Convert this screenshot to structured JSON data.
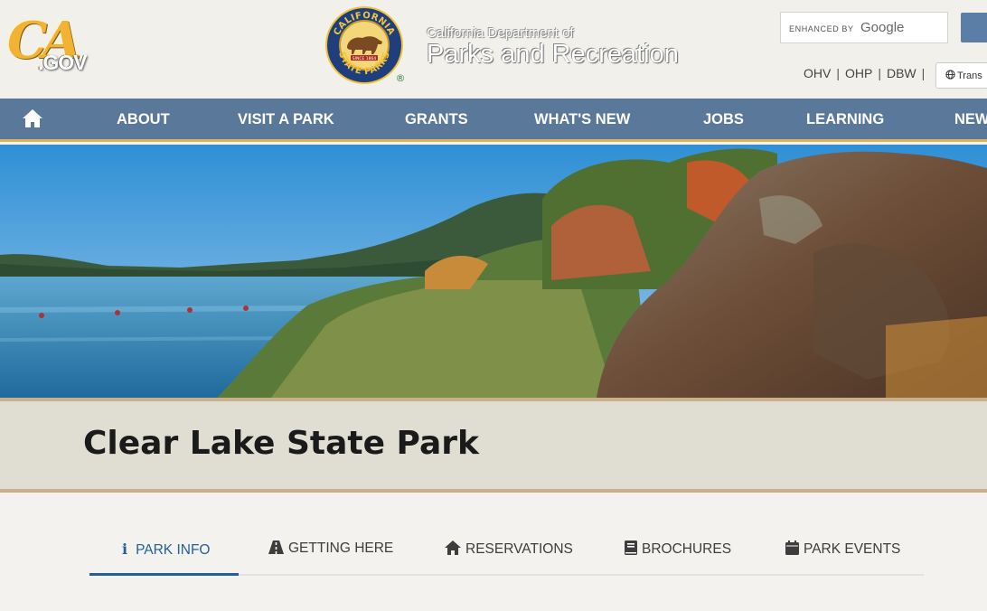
{
  "header": {
    "ca_logo_text": "CA",
    "ca_logo_suffix": ".GOV",
    "seal_top": "CALIFORNIA",
    "seal_bottom": "STATE PARKS",
    "seal_year": "SINCE 1864",
    "seal_mark": "®",
    "dept_small": "California Department of",
    "dept_big": "Parks and Recreation",
    "search": {
      "enhanced_by": "ENHANCED BY",
      "google": "Google"
    },
    "util_links": [
      "OHV",
      "OHP",
      "DBW"
    ],
    "translate_label": "Trans"
  },
  "nav": {
    "home_icon": "home-icon",
    "items": [
      "ABOUT",
      "VISIT A PARK",
      "GRANTS",
      "WHAT'S NEW",
      "JOBS",
      "LEARNING",
      "NEW"
    ]
  },
  "park": {
    "name_bold": "Clear Lake",
    "name_rest": "State Park"
  },
  "tabs": [
    {
      "label": "PARK INFO",
      "icon": "info-icon",
      "active": true
    },
    {
      "label": "GETTING HERE",
      "icon": "road-icon",
      "active": false
    },
    {
      "label": "RESERVATIONS",
      "icon": "home-icon",
      "active": false
    },
    {
      "label": "BROCHURES",
      "icon": "book-icon",
      "active": false
    },
    {
      "label": "PARK EVENTS",
      "icon": "calendar-icon",
      "active": false
    }
  ],
  "colors": {
    "nav_bg": "#5a789a",
    "nav_accent": "#e0b35a",
    "tab_active": "#23609a",
    "title_band": "#e0ddd2"
  }
}
